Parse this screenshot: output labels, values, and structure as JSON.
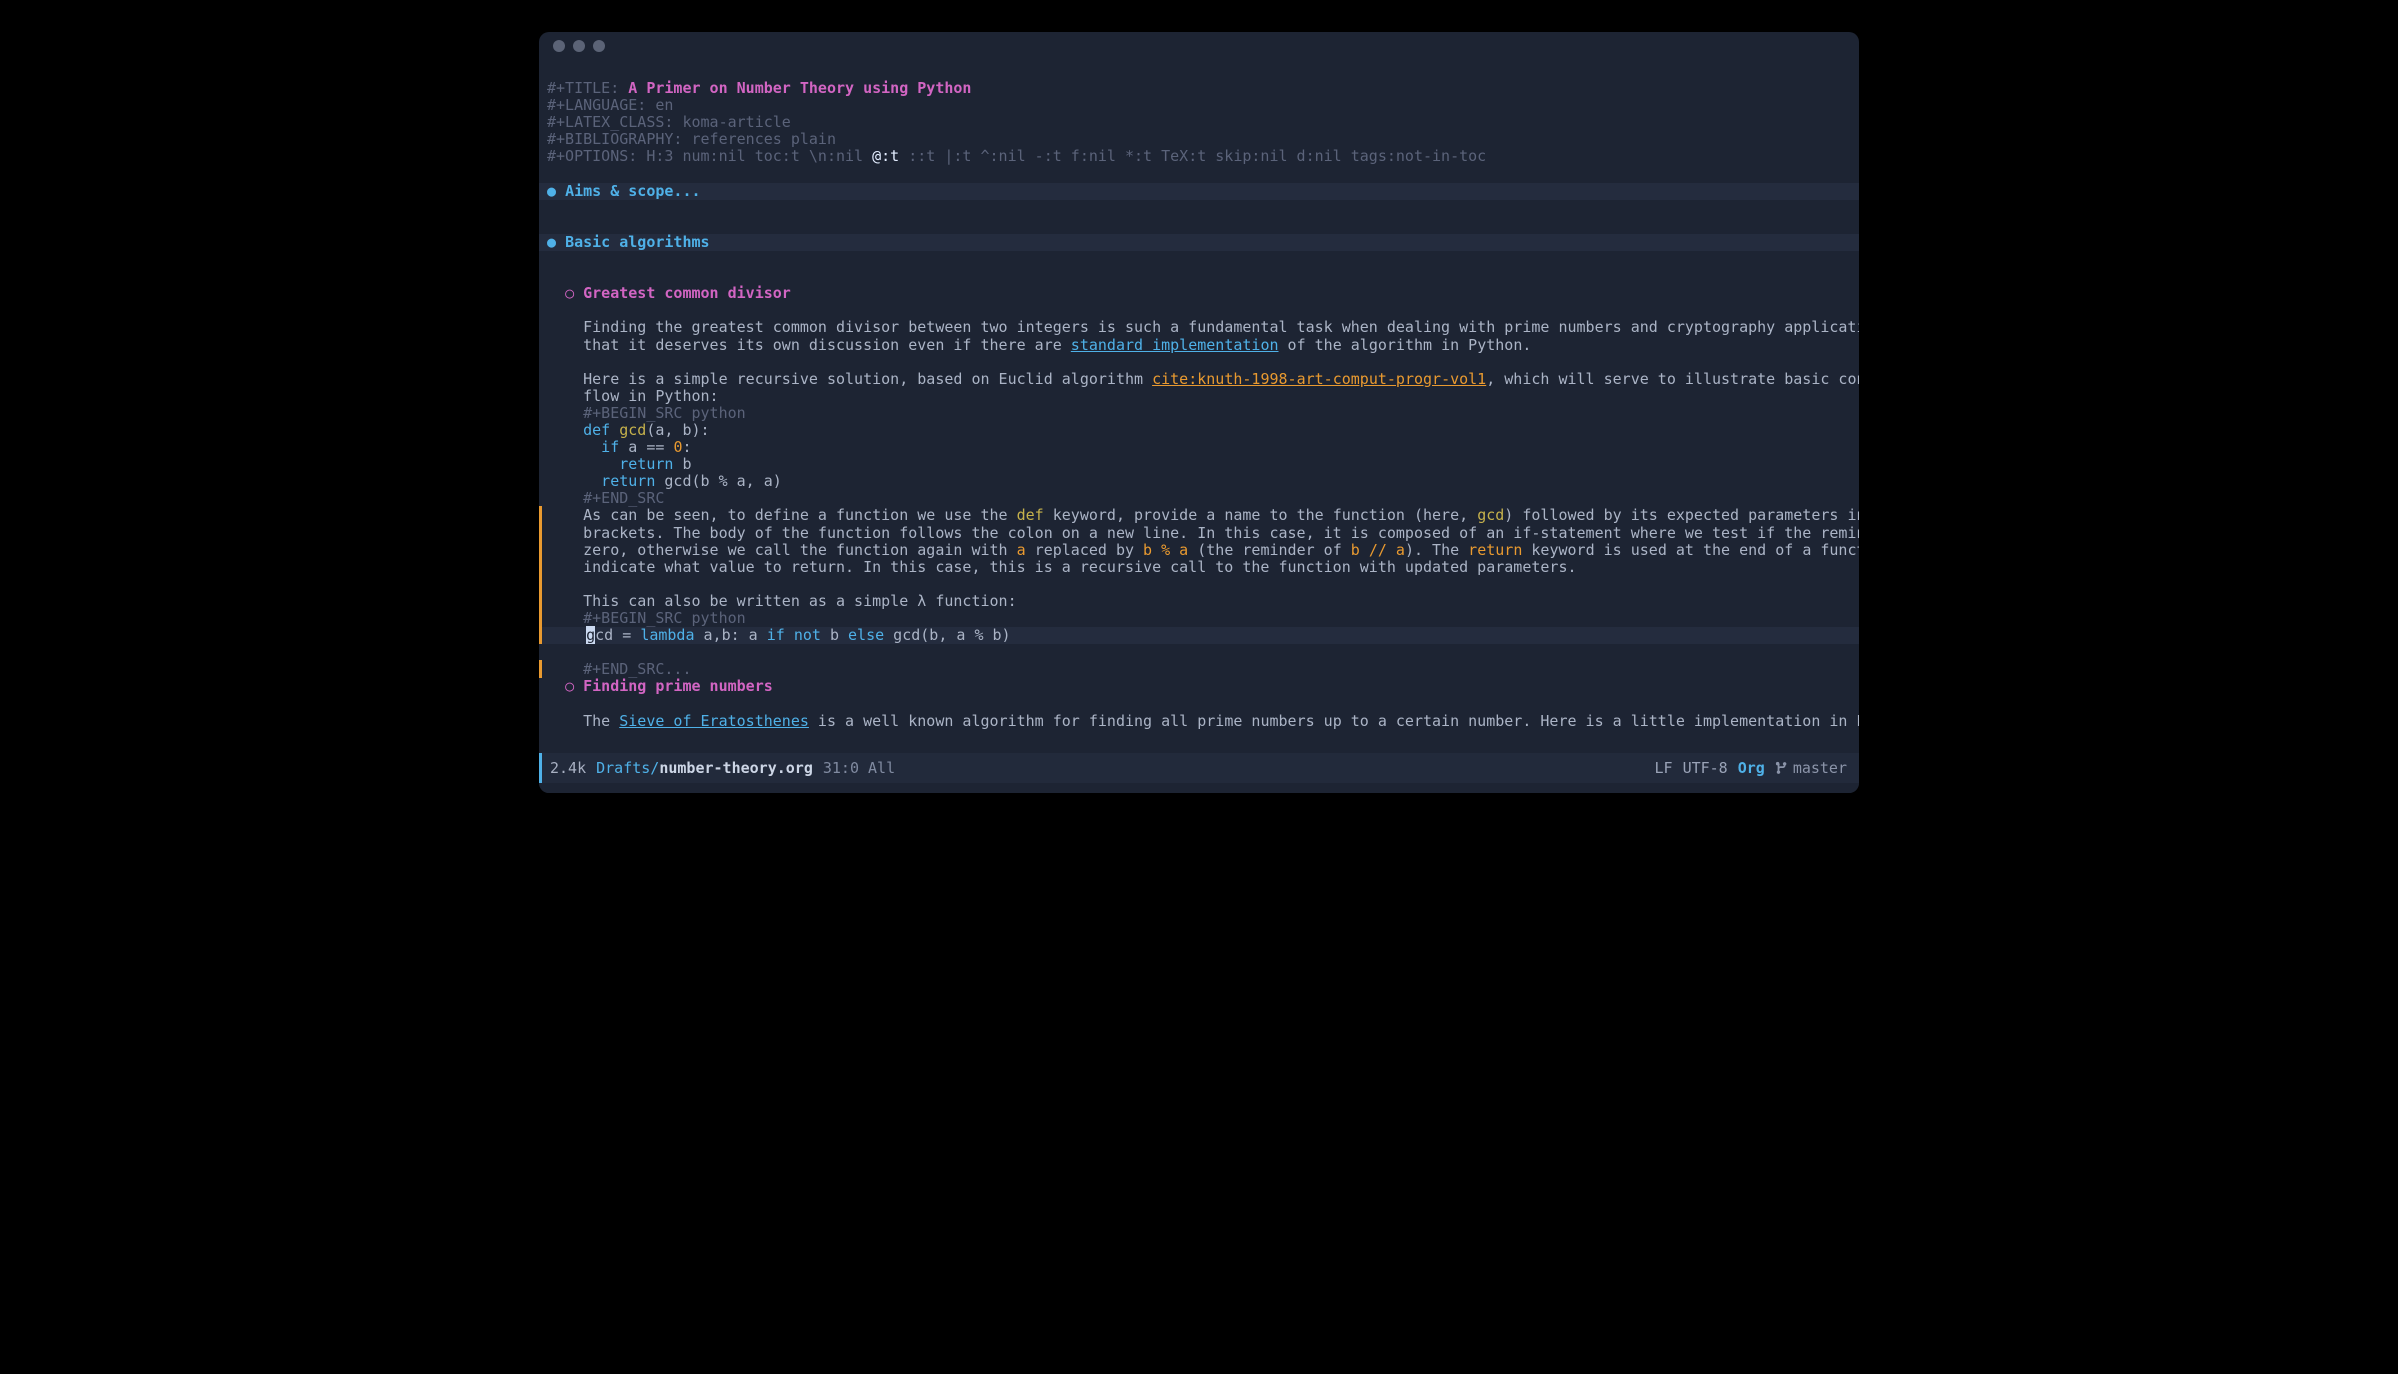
{
  "meta": {
    "title_kw": "#+TITLE: ",
    "title": "A Primer on Number Theory using Python",
    "language": "#+LANGUAGE: en",
    "latex": "#+LATEX_CLASS: koma-article",
    "bib": "#+BIBLIOGRAPHY: references plain",
    "opts_pre": "#+OPTIONS: H:3 num:nil toc:t \\n:nil ",
    "opts_at": "@:t",
    "opts_post": " ::t |:t ^:nil -:t f:nil *:t TeX:t skip:nil d:nil tags:not-in-toc"
  },
  "headings": {
    "h1a": "Aims & scope...",
    "h1b": "Basic algorithms",
    "h2a": "Greatest common divisor",
    "h2b": "Finding prime numbers",
    "bullet1": "●",
    "bullet2": "○"
  },
  "gcd": {
    "p1a": "Finding the greatest common divisor between two integers is such a fundamental task when dealing with prime numbers and cryptography applications",
    "p1b": "that it deserves its own discussion even if there are ",
    "link1": "standard implementation",
    "p1c": " of the algorithm in Python.",
    "p2a": "Here is a simple recursive solution, based on Euclid algorithm ",
    "cite": "cite:knuth-1998-art-comput-progr-vol1",
    "p2b": ", which will serve to illustrate basic control",
    "p2c": "flow in Python:",
    "src_begin": "#+BEGIN_SRC python",
    "code1_def": "def",
    "code1_fn": " gcd",
    "code1_rest": "(a, b):",
    "code2_if": "  if",
    "code2_rest": " a == ",
    "code2_zero": "0",
    "code2_colon": ":",
    "code3_ret": "    return",
    "code3_rest": " b",
    "code4_ret": "  return",
    "code4_rest": " gcd(b % a, a)",
    "src_end": "#+END_SRC",
    "p3a": "As can be seen, to define a function we use the ",
    "kw_def": "def",
    "p3b": " keyword, provide a name to the function (here, ",
    "kw_gcd": "gcd",
    "p3c": ") followed by its expected parameters into",
    "p3d": "brackets. The body of the function follows the colon on a new line. In this case, it is composed of an if-statement where we test if the reminder is",
    "p3e1": "zero, otherwise we call the function again with ",
    "kw_a": "a",
    "p3e2": " replaced by ",
    "kw_ba": "b % a",
    "p3e3": " (the reminder of ",
    "kw_bda": "b // a",
    "p3e4": "). The ",
    "kw_ret": "return",
    "p3e5": " keyword is used at the end of a function to",
    "p3f": "indicate what value to return. In this case, this is a recursive call to the function with updated parameters.",
    "p4": "This can also be written as a simple λ function:",
    "lam_cursor": "g",
    "lam1": "cd = ",
    "lam_kw1": "lambda",
    "lam2": " a,b: a ",
    "lam_kw2": "if",
    "lam3": " ",
    "lam_kw3": "not",
    "lam4": " b ",
    "lam_kw4": "else",
    "lam5": " gcd(b, a % b)",
    "src_end2": "#+END_SRC..."
  },
  "primes": {
    "p1a": "The ",
    "link": "Sieve of Eratosthenes",
    "p1b": " is a well known algorithm for finding all prime numbers up to a certain number. Here is a little implementation in Python:"
  },
  "modeline": {
    "size": "2.4k",
    "dir": "Drafts/",
    "file": "number-theory.org",
    "loc": "31:0 All",
    "lf": "LF",
    "enc": "UTF-8",
    "mode": "Org",
    "branch": "master"
  }
}
